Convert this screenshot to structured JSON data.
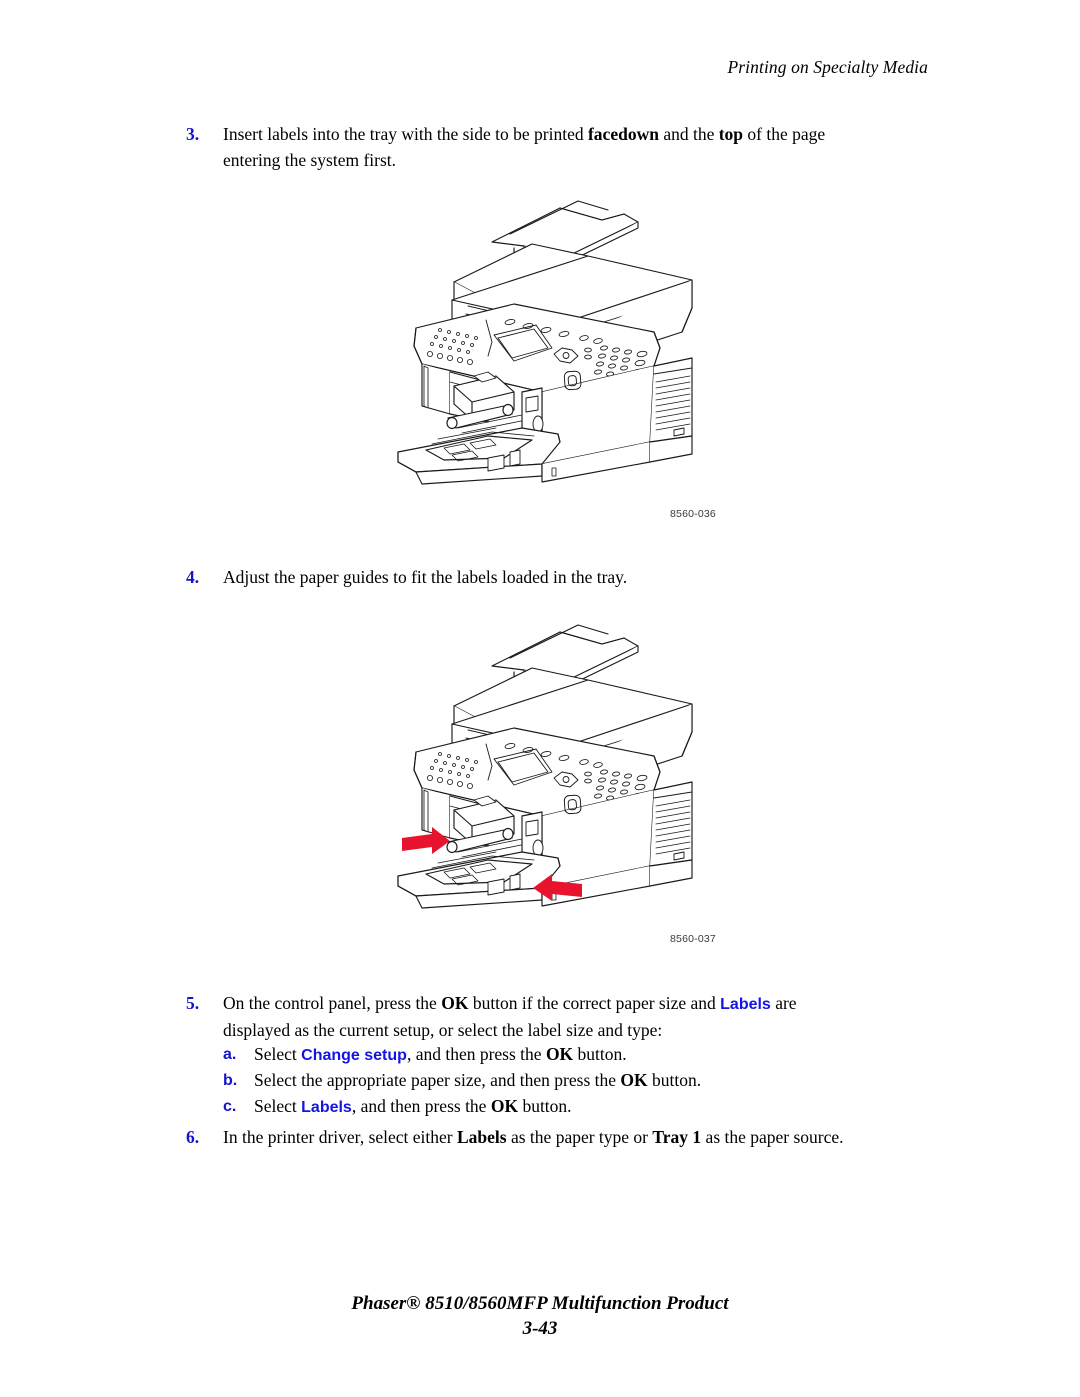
{
  "header": {
    "running_title": "Printing on Specialty Media"
  },
  "steps": [
    {
      "number": "3.",
      "line1_pre": "Insert labels into the tray with the side to be printed ",
      "bold1": "facedown",
      "line1_mid": " and the ",
      "bold2": "top",
      "line1_post": " of the page",
      "line2": "entering the system first."
    },
    {
      "number": "4.",
      "text": "Adjust the paper guides to fit the labels loaded in the tray."
    },
    {
      "number": "5.",
      "line1_pre": "On the control panel, press the ",
      "bold1": "OK",
      "line1_mid": " button if the correct paper size and ",
      "ui1": "Labels",
      "line1_post": " are",
      "line2": "displayed as the current setup, or select the label size and type:"
    },
    {
      "number": "6.",
      "pre": "In the printer driver, select either ",
      "bold1": "Labels",
      "mid": " as the paper type or ",
      "bold2": "Tray 1",
      "post": " as the paper source."
    }
  ],
  "substeps": [
    {
      "letter": "a.",
      "pre": "Select ",
      "ui": "Change setup",
      "mid": ", and then press the ",
      "bold": "OK",
      "post": " button."
    },
    {
      "letter": "b.",
      "pre": "Select the appropriate paper size, and then press the ",
      "ui": "",
      "mid": "",
      "bold": "OK",
      "post": " button."
    },
    {
      "letter": "c.",
      "pre": "Select ",
      "ui": "Labels",
      "mid": ", and then press the ",
      "bold": "OK",
      "post": " button."
    }
  ],
  "figures": [
    {
      "name": "printer-tray-open",
      "caption": "8560-036",
      "has_arrows": false,
      "alt": "Phaser 8510/8560MFP multifunction printer with Tray 1 open and labels loaded"
    },
    {
      "name": "printer-tray-guides",
      "caption": "8560-037",
      "has_arrows": true,
      "alt": "Phaser 8510/8560MFP multifunction printer with red arrows showing paper guides being adjusted"
    }
  ],
  "colors": {
    "step_number_blue": "#1414c8",
    "ui_term_blue": "#1414e6",
    "arrow_red": "#e8142d",
    "line_art": "#1a1a1a",
    "caption_gray": "#3a3a3a"
  },
  "footer": {
    "title": "Phaser® 8510/8560MFP Multifunction Product",
    "page": "3-43"
  }
}
